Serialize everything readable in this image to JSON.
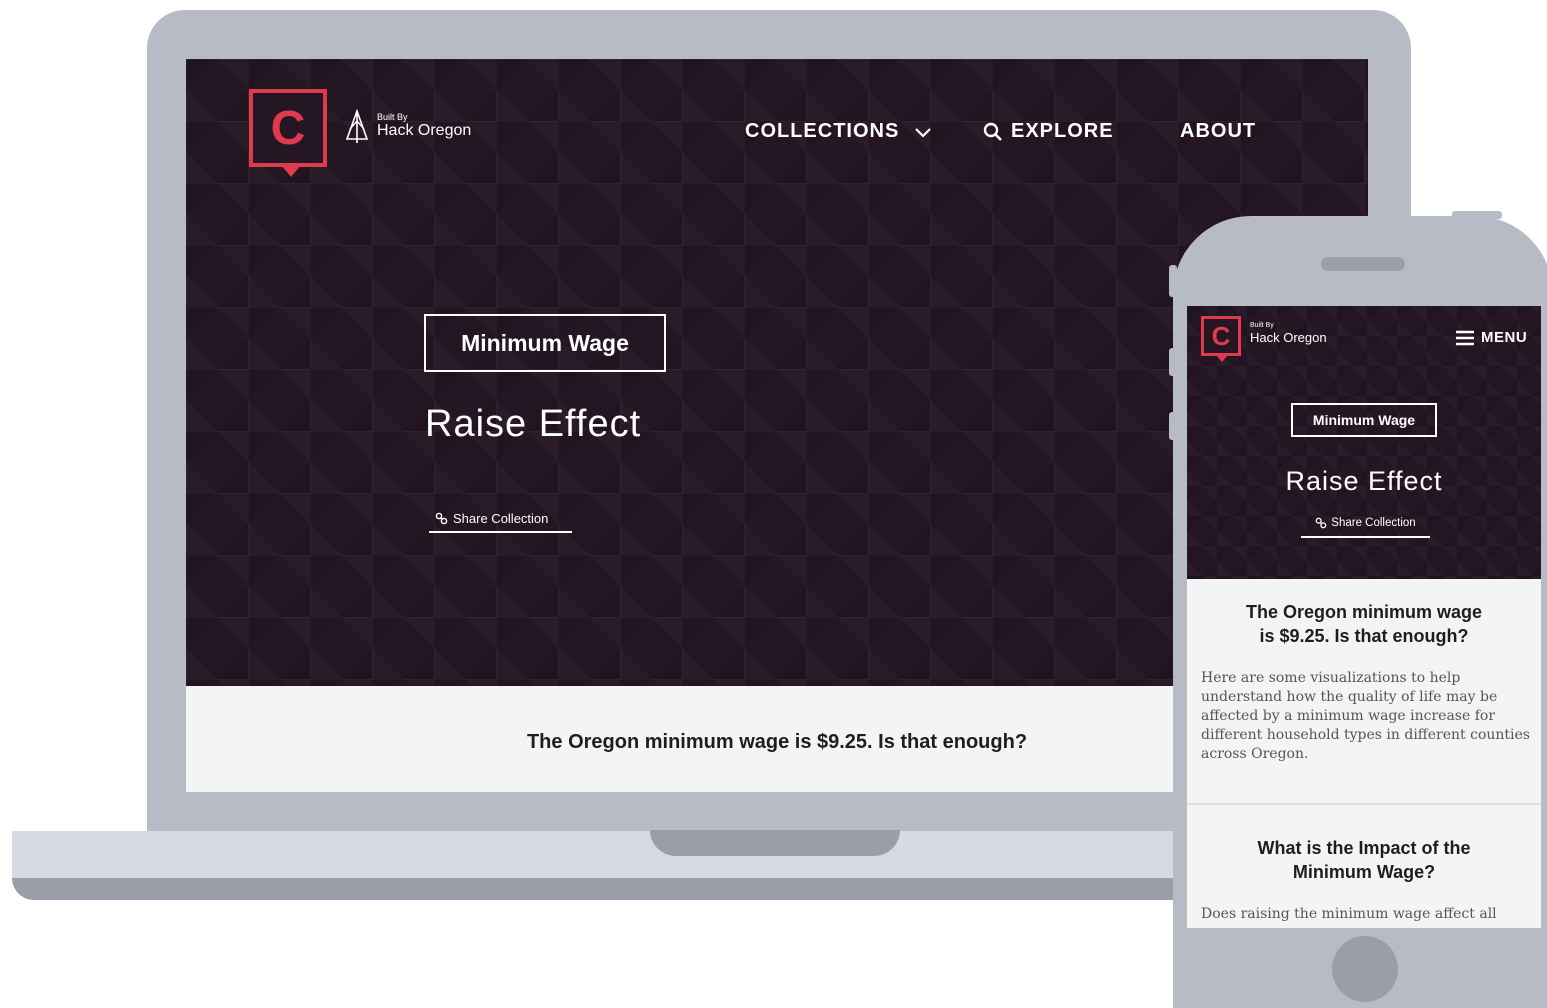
{
  "brand": {
    "logo_letter": "C",
    "built_by": "Built By",
    "org_name": "Hack Oregon"
  },
  "nav": {
    "collections": "COLLECTIONS",
    "explore": "EXPLORE",
    "about": "ABOUT",
    "menu": "MENU"
  },
  "hero": {
    "tag": "Minimum Wage",
    "title": "Raise Effect",
    "share": "Share Collection"
  },
  "content": {
    "question": "The Oregon minimum wage is $9.25. Is that enough?",
    "question_line1": "The Oregon minimum wage",
    "question_line2": "is $9.25. Is that enough?",
    "intro": "Here are some visualizations to help understand how the quality of life may be affected by a minimum wage increase for different household types in different counties across Oregon.",
    "impact_line1": "What is the Impact of the",
    "impact_line2": "Minimum Wage?",
    "impact_text": "Does raising the minimum wage affect all"
  },
  "colors": {
    "accent": "#e03a4f",
    "hero_bg": "#251624",
    "device_frame": "#b6bbc6"
  },
  "icons": {
    "chevron": "chevron-down-icon",
    "search": "search-icon",
    "link": "link-icon",
    "menu": "hamburger-icon",
    "tree": "tree-icon"
  }
}
